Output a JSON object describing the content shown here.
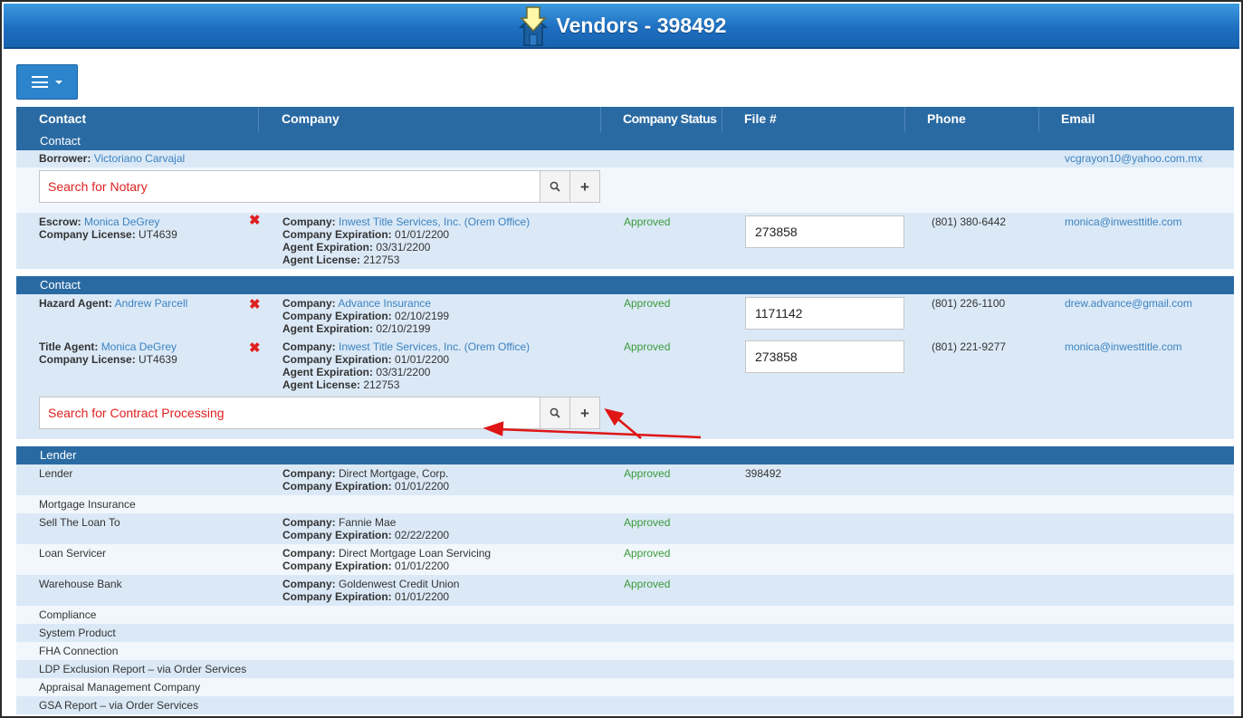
{
  "window": {
    "title": "Vendors - 398492"
  },
  "menu": {
    "icon": "hamburger-menu-icon"
  },
  "columns": {
    "contact": "Contact",
    "company": "Company",
    "status": "Company Status",
    "file": "File #",
    "phone": "Phone",
    "email": "Email"
  },
  "sections": {
    "contact1": "Contact",
    "contact2": "Contact",
    "lender": "Lender"
  },
  "borrower": {
    "label": "Borrower:",
    "name": "Victoriano Carvajal",
    "email": "vcgrayon10@yahoo.com.mx"
  },
  "search_notary": {
    "placeholder": "Search for Notary"
  },
  "search_contract": {
    "placeholder": "Search for Contract Processing"
  },
  "escrow": {
    "role": "Escrow:",
    "name": "Monica DeGrey",
    "license_label": "Company License:",
    "license": "UT4639",
    "company_label": "Company:",
    "company": "Inwest Title Services, Inc. (Orem Office)",
    "comp_exp_label": "Company Expiration:",
    "comp_exp": "01/01/2200",
    "agent_exp_label": "Agent Expiration:",
    "agent_exp": "03/31/2200",
    "agent_lic_label": "Agent License:",
    "agent_lic": "212753",
    "status": "Approved",
    "file": "273858",
    "phone": "(801) 380-6442",
    "email": "monica@inwesttitle.com"
  },
  "hazard": {
    "role": "Hazard Agent:",
    "name": "Andrew Parcell",
    "company_label": "Company:",
    "company": "Advance Insurance",
    "comp_exp_label": "Company Expiration:",
    "comp_exp": "02/10/2199",
    "agent_exp_label": "Agent Expiration:",
    "agent_exp": "02/10/2199",
    "status": "Approved",
    "file": "1171142",
    "phone": "(801) 226-1100",
    "email": "drew.advance@gmail.com"
  },
  "title_agent": {
    "role": "Title Agent:",
    "name": "Monica DeGrey",
    "license_label": "Company License:",
    "license": "UT4639",
    "company_label": "Company:",
    "company": "Inwest Title Services, Inc. (Orem Office)",
    "comp_exp_label": "Company Expiration:",
    "comp_exp": "01/01/2200",
    "agent_exp_label": "Agent Expiration:",
    "agent_exp": "03/31/2200",
    "agent_lic_label": "Agent License:",
    "agent_lic": "212753",
    "status": "Approved",
    "file": "273858",
    "phone": "(801) 221-9277",
    "email": "monica@inwesttitle.com"
  },
  "lender_rows": {
    "lender": {
      "name": "Lender",
      "company_label": "Company:",
      "company": "Direct Mortgage, Corp.",
      "exp_label": "Company Expiration:",
      "exp": "01/01/2200",
      "status": "Approved",
      "file": "398492"
    },
    "mi": {
      "name": "Mortgage Insurance"
    },
    "sell": {
      "name": "Sell The Loan To",
      "company_label": "Company:",
      "company": "Fannie Mae",
      "exp_label": "Company Expiration:",
      "exp": "02/22/2200",
      "status": "Approved"
    },
    "servicer": {
      "name": "Loan Servicer",
      "company_label": "Company:",
      "company": "Direct Mortgage Loan Servicing",
      "exp_label": "Company Expiration:",
      "exp": "01/01/2200",
      "status": "Approved"
    },
    "warehouse": {
      "name": "Warehouse Bank",
      "company_label": "Company:",
      "company": "Goldenwest Credit Union",
      "exp_label": "Company Expiration:",
      "exp": "01/01/2200",
      "status": "Approved"
    },
    "compliance": {
      "name": "Compliance"
    },
    "system": {
      "name": "System Product"
    },
    "fha": {
      "name": "FHA Connection"
    },
    "ldp": {
      "name": "LDP Exclusion Report – via Order Services"
    },
    "amc": {
      "name": "Appraisal Management Company"
    },
    "gsa": {
      "name": "GSA Report – via Order Services"
    }
  },
  "colors": {
    "header_blue": "#2a6aa3",
    "title_blue": "#1e6fc0",
    "link": "#3c82bf",
    "approved": "#3a9a3a",
    "alert_red": "#e02020"
  }
}
